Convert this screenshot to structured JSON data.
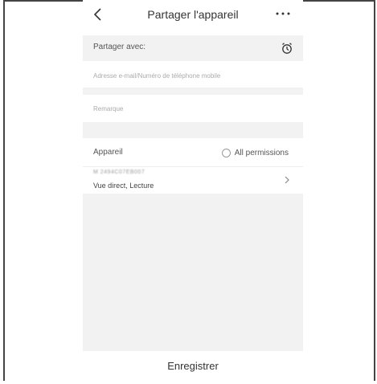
{
  "header": {
    "title": "Partager l'appareil",
    "back_icon": "chevron-left-icon",
    "more_icon": "more-horizontal-icon"
  },
  "share": {
    "label": "Partager avec:",
    "timer_icon": "timer-icon"
  },
  "email": {
    "placeholder": "Adresse e-mail/Numéro de téléphone mobile",
    "value": ""
  },
  "note": {
    "placeholder": "Remarque",
    "value": ""
  },
  "device_section": {
    "label": "Appareil",
    "all_permissions_label": "All permissions",
    "all_permissions_checked": false
  },
  "device": {
    "serial": "M 2494C07EB007",
    "permissions": "Vue direct, Lecture",
    "chevron_icon": "chevron-right-icon"
  },
  "footer": {
    "save_label": "Enregistrer"
  }
}
